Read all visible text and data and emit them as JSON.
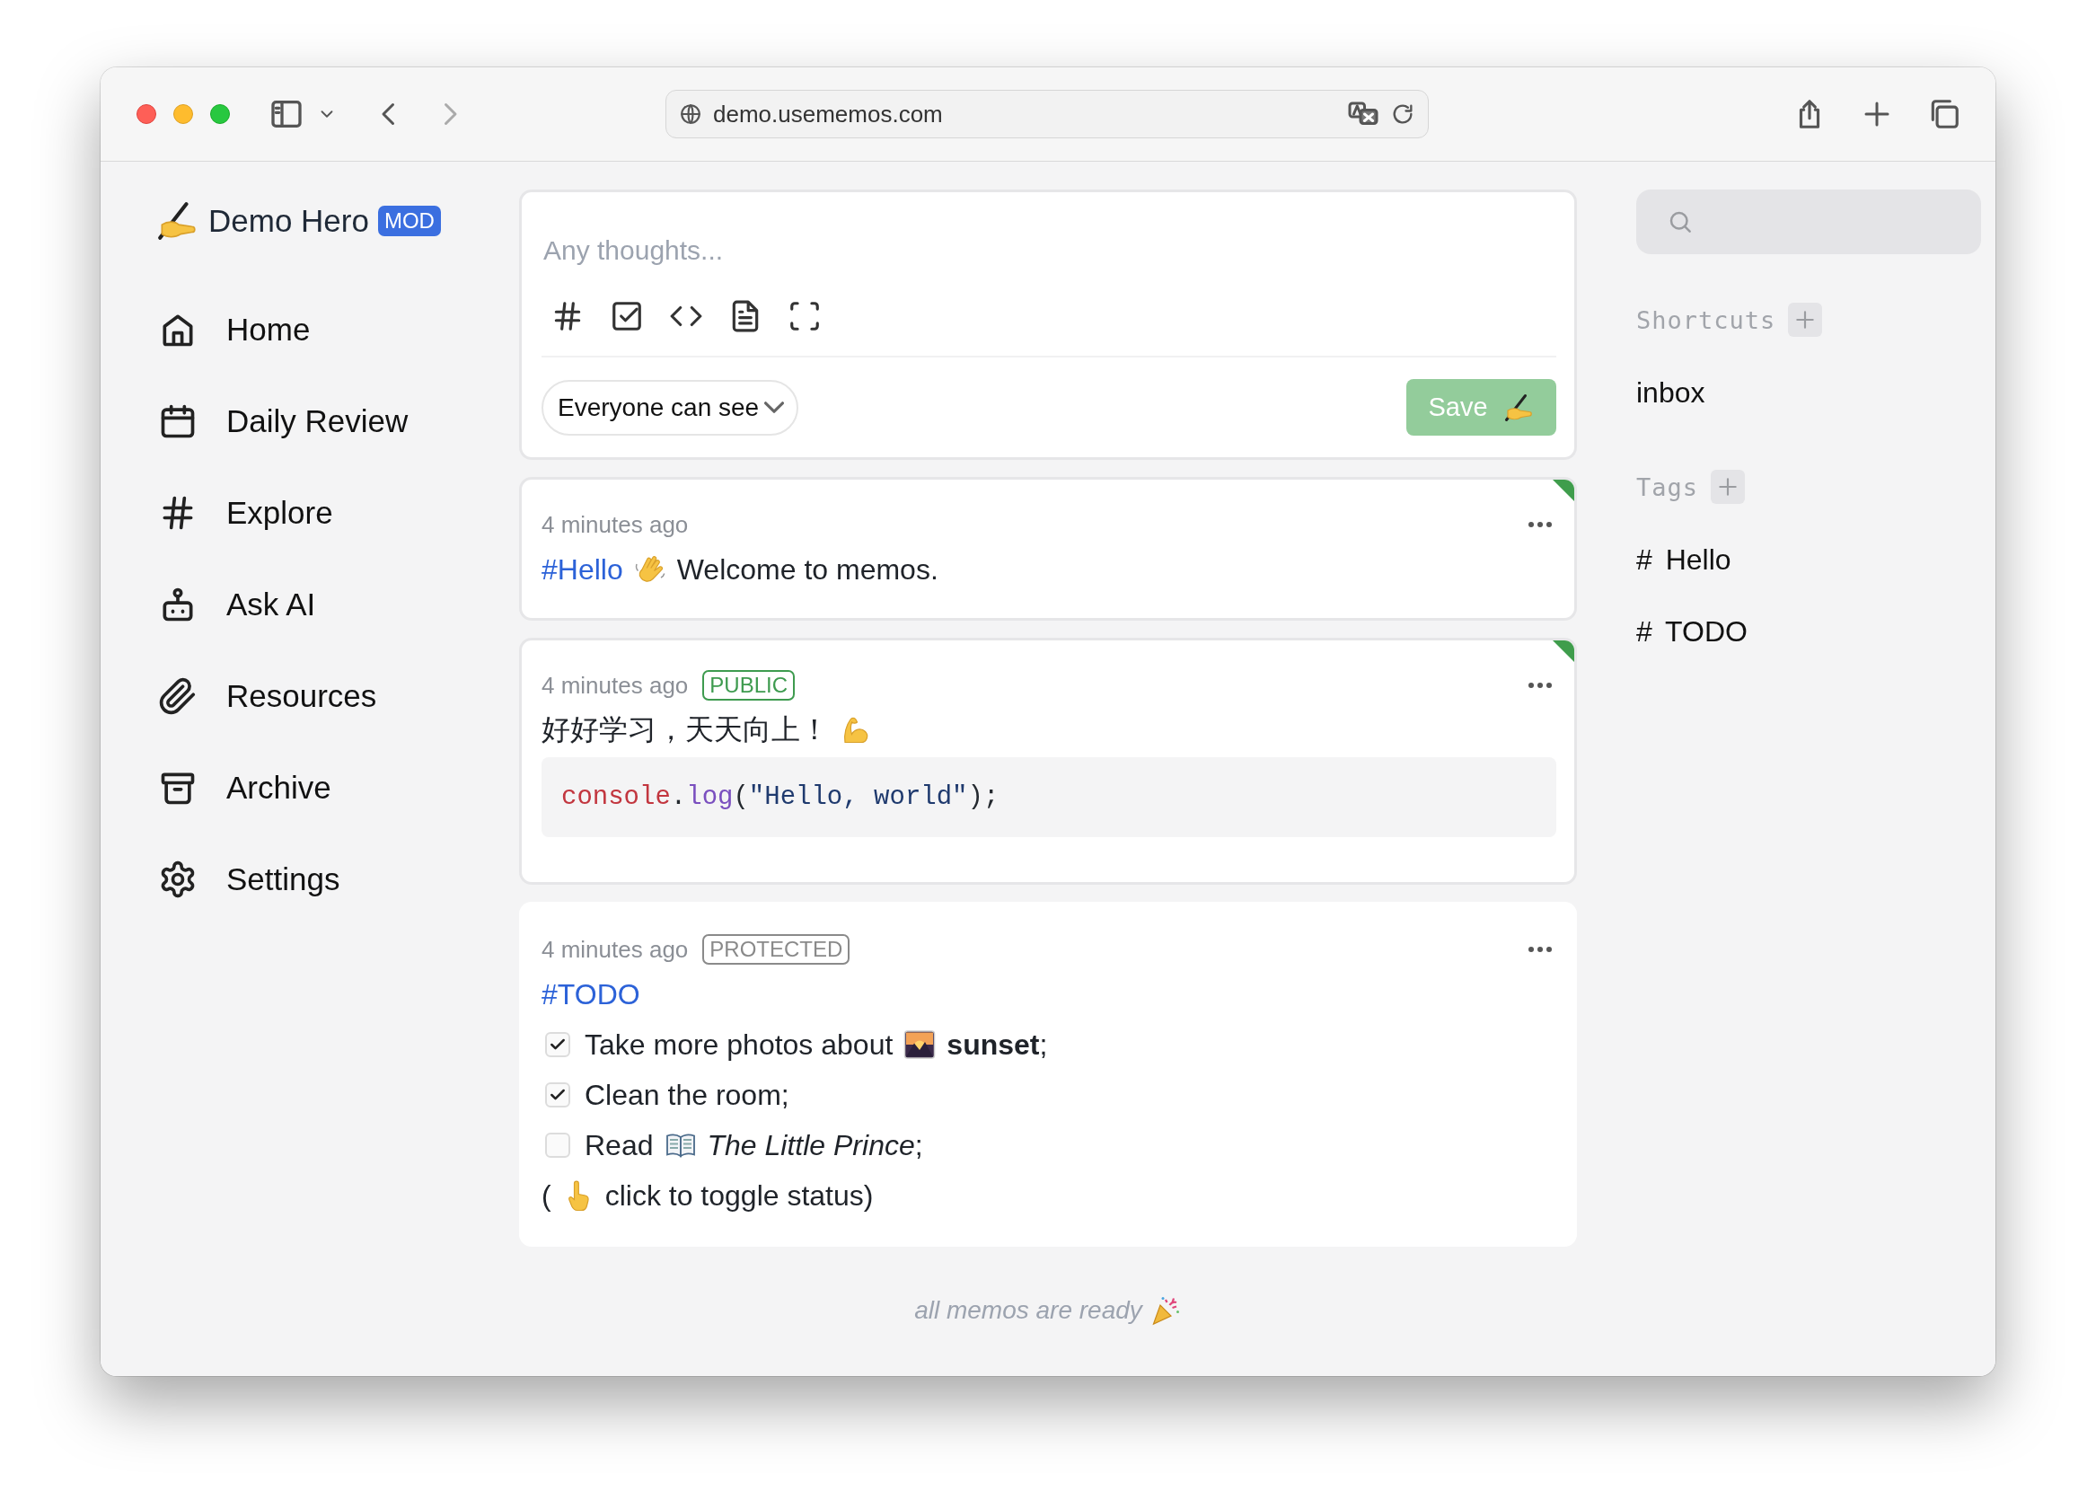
{
  "browser": {
    "url": "demo.usememos.com"
  },
  "sidebar": {
    "user": "Demo Hero",
    "role_badge": "MOD",
    "items": [
      {
        "label": "Home"
      },
      {
        "label": "Daily Review"
      },
      {
        "label": "Explore"
      },
      {
        "label": "Ask AI"
      },
      {
        "label": "Resources"
      },
      {
        "label": "Archive"
      },
      {
        "label": "Settings"
      }
    ]
  },
  "editor": {
    "placeholder": "Any thoughts...",
    "visibility": "Everyone can see",
    "save_label": "Save"
  },
  "memos": [
    {
      "time": "4 minutes ago",
      "pinned": true,
      "blocks": [
        {
          "kind": "line",
          "parts": [
            {
              "kind": "tag",
              "text": "#Hello"
            },
            {
              "kind": "waving-hand"
            },
            {
              "kind": "text",
              "text": "Welcome to memos."
            }
          ]
        }
      ]
    },
    {
      "time": "4 minutes ago",
      "pinned": true,
      "badge": {
        "text": "PUBLIC",
        "color": "#3e9b4f"
      },
      "blocks": [
        {
          "kind": "line",
          "parts": [
            {
              "kind": "text",
              "text": "好好学习，天天向上！"
            },
            {
              "kind": "muscle"
            }
          ]
        },
        {
          "kind": "code",
          "tokens": [
            {
              "text": "console",
              "color": "#c2363f"
            },
            {
              "text": ".",
              "color": "#24292f"
            },
            {
              "text": "log",
              "color": "#7a4fbf"
            },
            {
              "text": "(",
              "color": "#24292f"
            },
            {
              "text": "\"Hello, world\"",
              "color": "#1f3a6e"
            },
            {
              "text": ");",
              "color": "#24292f"
            }
          ]
        }
      ]
    },
    {
      "time": "4 minutes ago",
      "pinned": false,
      "badge": {
        "text": "PROTECTED",
        "color": "#8a8a8a"
      },
      "blocks": [
        {
          "kind": "line",
          "parts": [
            {
              "kind": "tag",
              "text": "#TODO"
            }
          ]
        },
        {
          "kind": "task",
          "checked": true,
          "parts": [
            {
              "kind": "text",
              "text": "Take more photos about"
            },
            {
              "kind": "sunset"
            },
            {
              "kind": "text",
              "text": "**sunset**;"
            }
          ]
        },
        {
          "kind": "task",
          "checked": true,
          "parts": [
            {
              "kind": "text",
              "text": "Clean the room;"
            }
          ]
        },
        {
          "kind": "task",
          "checked": false,
          "parts": [
            {
              "kind": "text",
              "text": "Read"
            },
            {
              "kind": "book"
            },
            {
              "kind": "text",
              "text": "*The Little Prince*;"
            }
          ]
        },
        {
          "kind": "line",
          "parts": [
            {
              "kind": "text",
              "text": "("
            },
            {
              "kind": "pointing-hand"
            },
            {
              "kind": "text",
              "text": "click to toggle status)"
            }
          ]
        }
      ]
    }
  ],
  "footer": "all memos are ready",
  "right": {
    "shortcuts": {
      "title": "Shortcuts",
      "items": [
        "inbox"
      ]
    },
    "tags": {
      "title": "Tags",
      "items": [
        "# Hello",
        "# TODO"
      ]
    }
  }
}
